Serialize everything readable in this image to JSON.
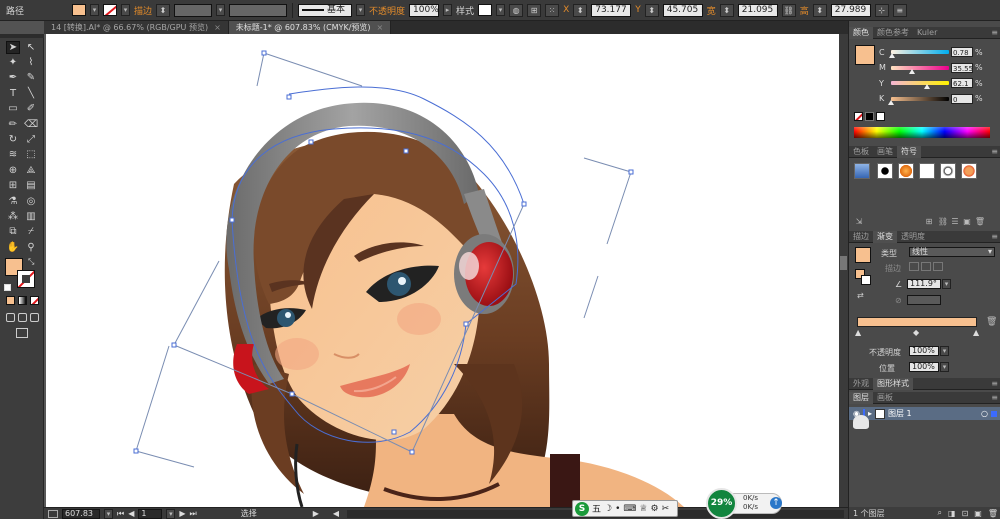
{
  "control_bar": {
    "object_label": "路径",
    "stroke_label": "描边",
    "stroke_profile": "基本",
    "opacity_label": "不透明度",
    "opacity_value": "100%",
    "style_label": "样式",
    "x_label": "X",
    "x_value": "73.177 mm",
    "y_label": "Y",
    "y_value": "45.705 mm",
    "w_label": "宽",
    "w_value": "21.095 mm",
    "h_label": "高",
    "h_value": "27.989 mm",
    "fill_color": "#f7c08f"
  },
  "tabs": [
    {
      "label": "14 [转换].AI* @ 66.67% (RGB/GPU 预览)",
      "close": "×",
      "active": false
    },
    {
      "label": "未标题-1* @ 607.83% (CMYK/预览)",
      "close": "×",
      "active": true
    }
  ],
  "toolbar": {
    "tools": [
      {
        "name": "selection-tool",
        "glyph": "➤"
      },
      {
        "name": "direct-selection-tool",
        "glyph": "↖"
      },
      {
        "name": "magic-wand-tool",
        "glyph": "✦"
      },
      {
        "name": "lasso-tool",
        "glyph": "⌇"
      },
      {
        "name": "pen-tool",
        "glyph": "✒"
      },
      {
        "name": "curvature-tool",
        "glyph": "✎"
      },
      {
        "name": "type-tool",
        "glyph": "T"
      },
      {
        "name": "line-tool",
        "glyph": "╲"
      },
      {
        "name": "rectangle-tool",
        "glyph": "▭"
      },
      {
        "name": "paintbrush-tool",
        "glyph": "✐"
      },
      {
        "name": "pencil-tool",
        "glyph": "✏"
      },
      {
        "name": "eraser-tool",
        "glyph": "⌫"
      },
      {
        "name": "rotate-tool",
        "glyph": "↻"
      },
      {
        "name": "scale-tool",
        "glyph": "⤢"
      },
      {
        "name": "warp-tool",
        "glyph": "≋"
      },
      {
        "name": "free-transform-tool",
        "glyph": "⬚"
      },
      {
        "name": "shape-builder-tool",
        "glyph": "⊕"
      },
      {
        "name": "perspective-grid-tool",
        "glyph": "⟁"
      },
      {
        "name": "mesh-tool",
        "glyph": "⊞"
      },
      {
        "name": "gradient-tool",
        "glyph": "▤"
      },
      {
        "name": "eyedropper-tool",
        "glyph": "⚗"
      },
      {
        "name": "blend-tool",
        "glyph": "◎"
      },
      {
        "name": "symbol-sprayer-tool",
        "glyph": "⁂"
      },
      {
        "name": "column-graph-tool",
        "glyph": "▥"
      },
      {
        "name": "artboard-tool",
        "glyph": "⧉"
      },
      {
        "name": "slice-tool",
        "glyph": "⌿"
      },
      {
        "name": "hand-tool",
        "glyph": "✋"
      },
      {
        "name": "zoom-tool",
        "glyph": "⚲"
      }
    ],
    "fill_color": "#f7c08f"
  },
  "status": {
    "zoom": "607.83",
    "artboard": "1",
    "mode": "选择"
  },
  "ime": {
    "logo": "S",
    "mode": "五"
  },
  "network": {
    "percent": "29%",
    "up": "0K/s",
    "down": "0K/s"
  },
  "color_panel": {
    "tabs": [
      "颜色",
      "颜色参考",
      "Kuler"
    ],
    "swatch": "#f7c08f",
    "channels": [
      {
        "label": "C",
        "value": "0.78",
        "knob": 0.01,
        "gradient": "linear-gradient(to right,#fff1e0,#00aeef)"
      },
      {
        "label": "M",
        "value": "35.55",
        "knob": 0.36,
        "gradient": "linear-gradient(to right,#ffe3c0,#ec008c)"
      },
      {
        "label": "Y",
        "value": "62.1",
        "knob": 0.62,
        "gradient": "linear-gradient(to right,#f5b5d5,#fff200)"
      },
      {
        "label": "K",
        "value": "0",
        "knob": 0.0,
        "gradient": "linear-gradient(to right,#f7c08f,#000000)"
      }
    ],
    "pct": "%"
  },
  "swatches_panel": {
    "tabs": [
      "色板",
      "画笔",
      "符号"
    ]
  },
  "gradient_panel": {
    "tabs": [
      "描边",
      "渐变",
      "透明度"
    ],
    "type_label": "类型",
    "type_value": "线性",
    "stroke_label": "描边",
    "angle_value": "111.9°",
    "opacity_label": "不透明度",
    "opacity_value": "100%",
    "location_label": "位置",
    "location_value": "100%",
    "bar_gradient": "linear-gradient(to right,#f7c08f,#f7c08f)"
  },
  "appearance_panel": {
    "tabs": [
      "外观",
      "图形样式"
    ]
  },
  "layers_panel": {
    "tabs": [
      "图层",
      "画板"
    ],
    "layer_name": "图层 1",
    "count_label": "1 个图层"
  }
}
